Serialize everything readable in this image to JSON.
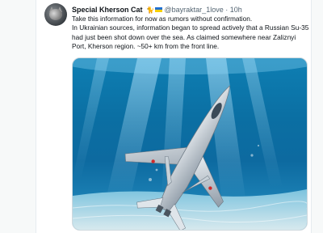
{
  "tweet": {
    "author_name": "Special Kherson Cat",
    "author_badge_emoji": "🐈",
    "author_badge_flag": "ukraine-flag",
    "handle": "@bayraktar_1love",
    "separator": "·",
    "time": "10h",
    "paragraphs": [
      "Take this information for now as rumors without confirmation.",
      "In Ukrainian sources, information began to spread actively that a Russian Su-35 had just been shot down over the sea. As claimed somewhere near Zaliznyi Port, Kherson region. ~50+ km from the front line."
    ],
    "media": {
      "icon": "fighter-jet-underwater-image"
    }
  },
  "colors": {
    "text_primary": "#0f1419",
    "text_secondary": "#536471",
    "water_deep": "#0b6fa3",
    "water_light": "#4aa7cf",
    "seabed": "#d7e9ee"
  }
}
